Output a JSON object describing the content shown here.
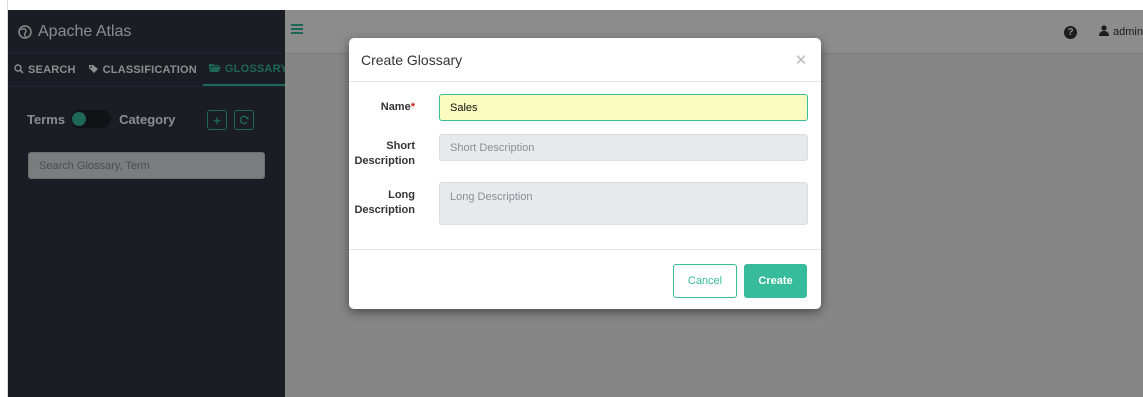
{
  "app": {
    "title": "Apache Atlas",
    "brand_icon": "globe-icon"
  },
  "sidebar": {
    "tabs": [
      {
        "label": "SEARCH",
        "icon": "search-icon",
        "active": false
      },
      {
        "label": "CLASSIFICATION",
        "icon": "tag-icon",
        "active": false
      },
      {
        "label": "GLOSSARY",
        "icon": "folder-open-icon",
        "active": true
      }
    ],
    "toggle": {
      "left_label": "Terms",
      "right_label": "Category"
    },
    "add_icon": "plus-icon",
    "refresh_icon": "refresh-icon",
    "search_placeholder": "Search Glossary, Term"
  },
  "header": {
    "menu_icon": "hamburger-icon",
    "help_icon": "question-circle-icon",
    "user_icon": "user-icon",
    "user_label": "admin"
  },
  "modal": {
    "title": "Create Glossary",
    "close_icon": "close-icon",
    "fields": {
      "name": {
        "label": "Name",
        "required_mark": "*",
        "value": "Sales"
      },
      "short_description": {
        "label_line1": "Short",
        "label_line2": "Description",
        "placeholder": "Short Description"
      },
      "long_description": {
        "label_line1": "Long",
        "label_line2": "Description",
        "placeholder": "Long Description"
      }
    },
    "buttons": {
      "cancel": "Cancel",
      "create": "Create"
    }
  },
  "colors": {
    "accent": "#37bb9b",
    "sidebar_bg": "#323544",
    "name_input_bg": "#fafdbf"
  }
}
